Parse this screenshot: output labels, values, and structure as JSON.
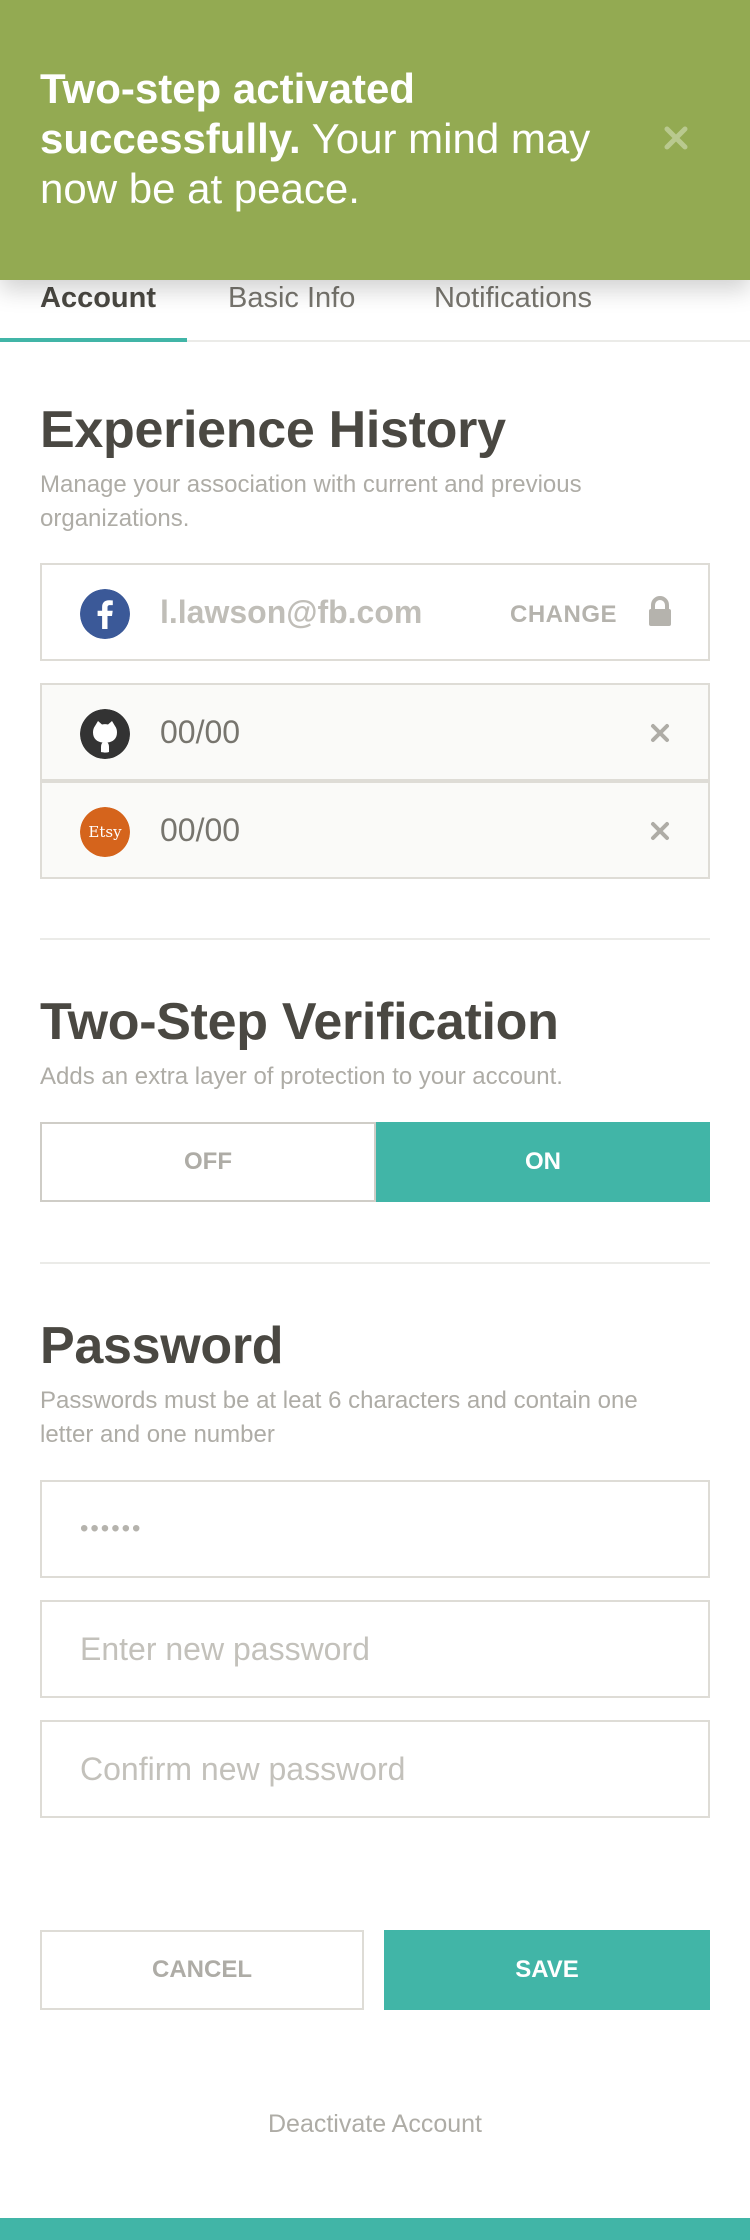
{
  "toast": {
    "bold_text": "Two-step activated successfully.",
    "text": " Your mind may now be at peace.",
    "close_icon": "close-icon",
    "color": "#93aa52"
  },
  "tabs": [
    {
      "label": "Account",
      "active": true
    },
    {
      "label": "Basic Info",
      "active": false
    },
    {
      "label": "Notifications",
      "active": false
    }
  ],
  "experience": {
    "title": "Experience History",
    "description": "Manage your association with current and previous organizations.",
    "accounts": [
      {
        "icon": "facebook-icon",
        "value": "l.lawson@fb.com",
        "action": "CHANGE",
        "trailing_icon": "lock-icon"
      },
      {
        "icon": "github-icon",
        "value": "00/00",
        "trailing_icon": "close-icon"
      },
      {
        "icon": "etsy-icon",
        "icon_text": "Etsy",
        "value": "00/00",
        "trailing_icon": "close-icon"
      }
    ]
  },
  "two_step": {
    "title": "Two-Step Verification",
    "description": "Adds an extra layer of protection to your account.",
    "off_label": "OFF",
    "on_label": "ON",
    "selected": "ON"
  },
  "password": {
    "title": "Password",
    "description": "Passwords must be at leat 6 characters and contain one letter and one number",
    "current_value": "••••••",
    "new_placeholder": "Enter new password",
    "confirm_placeholder": "Confirm new password"
  },
  "actions": {
    "cancel_label": "CANCEL",
    "save_label": "SAVE",
    "deactivate_label": "Deactivate Account"
  },
  "colors": {
    "accent": "#41b5a7",
    "toast": "#93aa52",
    "facebook": "#3b5998",
    "github": "#333333",
    "etsy": "#d5641c"
  }
}
